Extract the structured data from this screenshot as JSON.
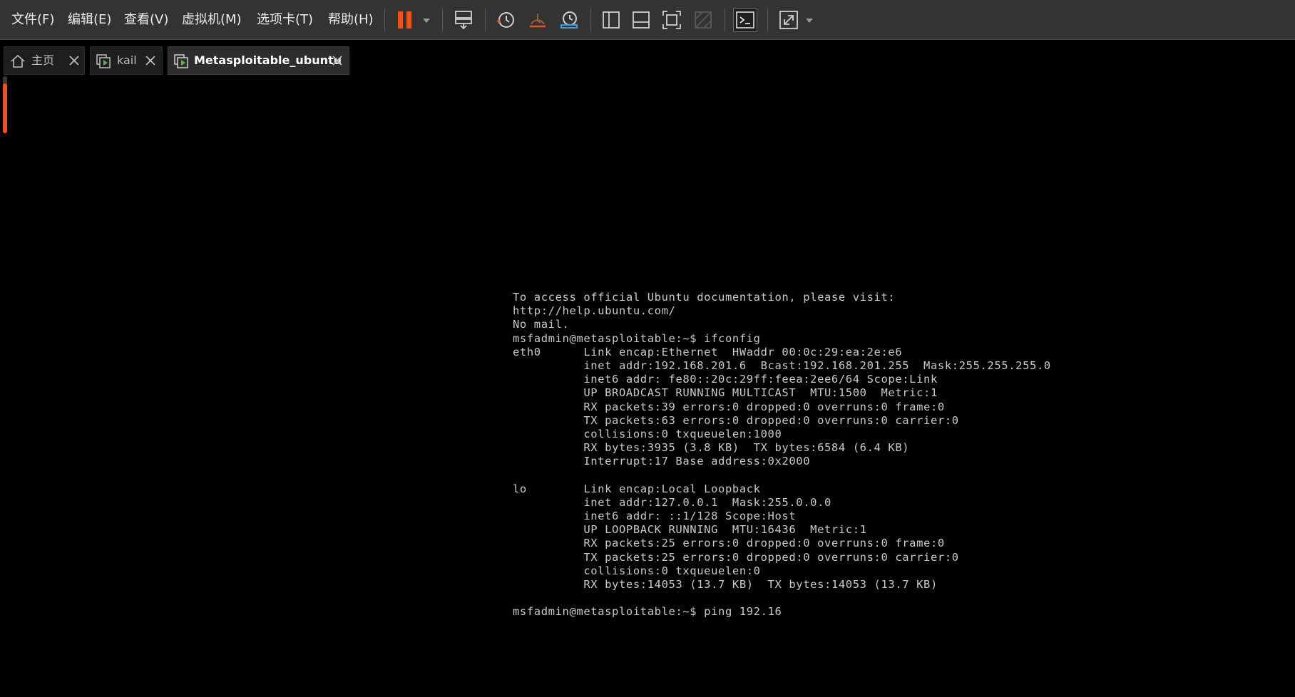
{
  "menu": {
    "file": "文件(F)",
    "edit": "编辑(E)",
    "view": "查看(V)",
    "vm": "虚拟机(M)",
    "tabs": "选项卡(T)",
    "help": "帮助(H)"
  },
  "toolbar": {
    "icons": [
      "pause-icon",
      "send-ctrl-alt-del-icon",
      "take-snapshot-icon",
      "revert-snapshot-icon",
      "snapshot-manager-icon",
      "show-library-icon",
      "show-thumbnail-bar-icon",
      "full-screen-icon",
      "unity-icon",
      "console-view-icon",
      "stretch-guest-icon"
    ],
    "accent_color": "#e8541e"
  },
  "tabs": [
    {
      "label": "主页",
      "icon": "home-icon"
    },
    {
      "label": "kail",
      "icon": "vm-running-icon"
    },
    {
      "label": "Metasploitable_ubuntu",
      "icon": "vm-running-icon",
      "active": true
    }
  ],
  "terminal": {
    "lines": [
      "To access official Ubuntu documentation, please visit:",
      "http://help.ubuntu.com/",
      "No mail.",
      "msfadmin@metasploitable:~$ ifconfig",
      "eth0      Link encap:Ethernet  HWaddr 00:0c:29:ea:2e:e6",
      "          inet addr:192.168.201.6  Bcast:192.168.201.255  Mask:255.255.255.0",
      "          inet6 addr: fe80::20c:29ff:feea:2ee6/64 Scope:Link",
      "          UP BROADCAST RUNNING MULTICAST  MTU:1500  Metric:1",
      "          RX packets:39 errors:0 dropped:0 overruns:0 frame:0",
      "          TX packets:63 errors:0 dropped:0 overruns:0 carrier:0",
      "          collisions:0 txqueuelen:1000",
      "          RX bytes:3935 (3.8 KB)  TX bytes:6584 (6.4 KB)",
      "          Interrupt:17 Base address:0x2000",
      "",
      "lo        Link encap:Local Loopback",
      "          inet addr:127.0.0.1  Mask:255.0.0.0",
      "          inet6 addr: ::1/128 Scope:Host",
      "          UP LOOPBACK RUNNING  MTU:16436  Metric:1",
      "          RX packets:25 errors:0 dropped:0 overruns:0 frame:0",
      "          TX packets:25 errors:0 dropped:0 overruns:0 carrier:0",
      "          collisions:0 txqueuelen:0",
      "          RX bytes:14053 (13.7 KB)  TX bytes:14053 (13.7 KB)",
      "",
      "msfadmin@metasploitable:~$ ping 192.16"
    ]
  }
}
